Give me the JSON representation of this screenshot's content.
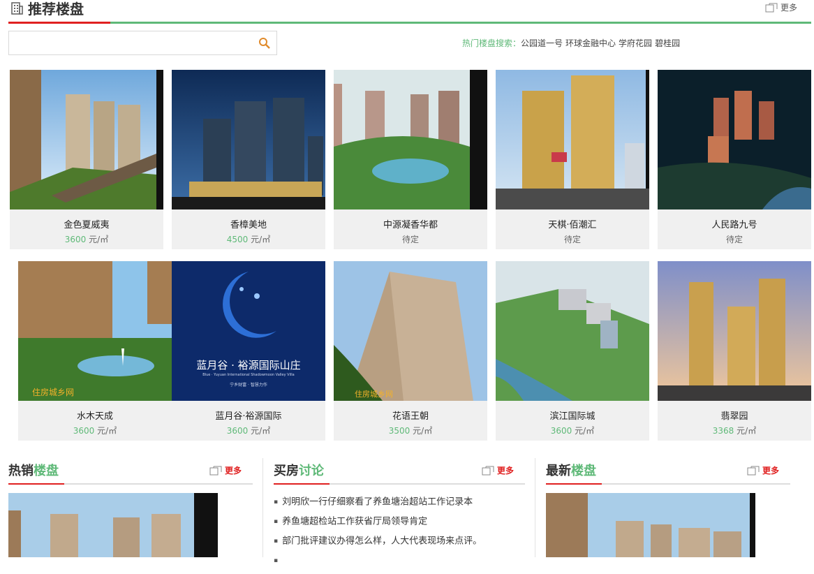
{
  "header": {
    "title": "推荐楼盘",
    "more": "更多"
  },
  "search": {
    "placeholder": "",
    "value": ""
  },
  "hot_search": {
    "label": "热门楼盘搜索：",
    "keywords": [
      "公园道一号",
      "环球金融中心",
      "学府花园",
      "碧桂园"
    ]
  },
  "unit": "元/㎡",
  "listings": [
    {
      "name": "金色夏威夷",
      "price": "3600",
      "status": ""
    },
    {
      "name": "香樟美地",
      "price": "4500",
      "status": ""
    },
    {
      "name": "中源凝香华都",
      "price": "",
      "status": "待定"
    },
    {
      "name": "天棋·佰潮汇",
      "price": "",
      "status": "待定"
    },
    {
      "name": "人民路九号",
      "price": "",
      "status": "待定"
    },
    {
      "name": "水木天成",
      "price": "3600",
      "status": ""
    },
    {
      "name": "蓝月谷·裕源国际",
      "price": "3600",
      "status": ""
    },
    {
      "name": "花语王朝",
      "price": "3500",
      "status": ""
    },
    {
      "name": "滨江国际城",
      "price": "3600",
      "status": ""
    },
    {
      "name": "翡翠园",
      "price": "3368",
      "status": ""
    }
  ],
  "poster": {
    "title": "蓝月谷 · 裕源国际山庄",
    "subtitle": "Blue · Yuyuan International Shadowmoon Valley Villa",
    "slogan": "宁乡财富 · 智慧力作"
  },
  "sections": {
    "hot": {
      "a": "热销",
      "b": "楼盘",
      "more": "更多"
    },
    "discuss": {
      "a": "买房",
      "b": "讨论",
      "more": "更多"
    },
    "newest": {
      "a": "最新",
      "b": "楼盘",
      "more": "更多"
    }
  },
  "news": [
    "刘明欣一行仔细察看了养鱼塘治超站工作记录本",
    "养鱼塘超检站工作获省厅局领导肯定",
    "部门批评建议办得怎么样，人大代表现场来点评。",
    ""
  ]
}
